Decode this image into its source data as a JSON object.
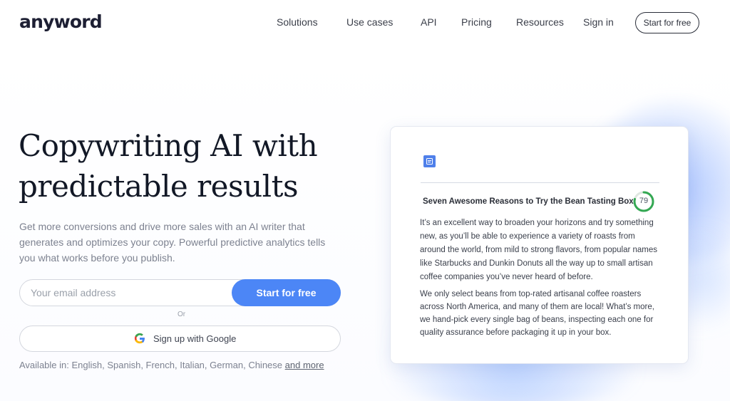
{
  "header": {
    "logo": "anyword",
    "nav": {
      "solutions": "Solutions",
      "use_cases": "Use cases",
      "api": "API",
      "pricing": "Pricing",
      "resources": "Resources",
      "sign_in": "Sign in"
    },
    "cta": "Start for free"
  },
  "hero": {
    "title_line_1": "Copywriting AI with",
    "title_line_2": "predictable results",
    "description": "Get more conversions and drive more sales with an AI writer that generates and optimizes your copy. Powerful predictive analytics tells you what works before you publish."
  },
  "signup": {
    "email_placeholder": "Your email address",
    "submit_label": "Start for free",
    "or_label": "Or",
    "google_label": "Sign up with Google"
  },
  "availability": {
    "prefix": "Available in: English, Spanish, French, Italian, German, Chinese",
    "link": "and more"
  },
  "sample": {
    "title": "Seven Awesome Reasons to Try the Bean Tasting Box",
    "score": "79",
    "paragraphs": [
      "It’s an excellent way to broaden your horizons and try something new, as you’ll be able to experience a variety of roasts from around the world, from mild to strong flavors, from popular names like Starbucks and Dunkin Donuts all the way up to small artisan coffee companies you’ve never heard of before.",
      "We only select beans from top-rated artisanal coffee roasters across North America, and many of them are local! What’s more, we hand-pick every single bag of beans, inspecting each one for quality assurance before packaging it up in your box."
    ]
  },
  "colors": {
    "accent": "#4c86f6",
    "text": "#121826",
    "muted": "#7d8290",
    "score_ring": "#34a853"
  },
  "icons": {
    "document": "document-icon",
    "google": "google-icon"
  }
}
